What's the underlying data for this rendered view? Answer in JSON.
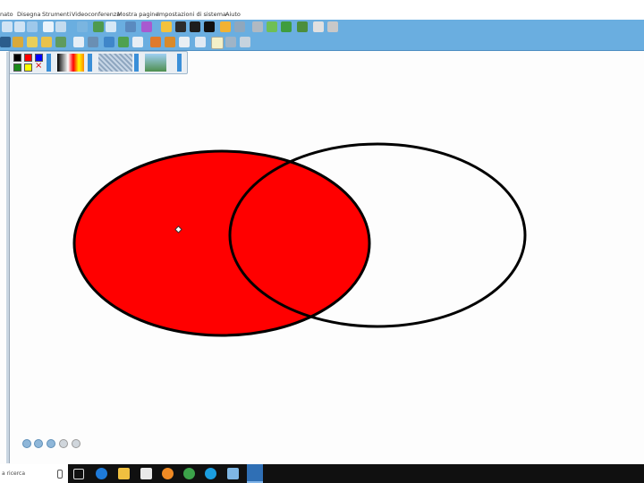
{
  "menu": {
    "items": [
      "nato",
      "Disegna",
      "Strumenti",
      "Videoconferenza",
      "Mostra pagine",
      "Impostazioni di sistema",
      "Aiuto"
    ]
  },
  "toolbar1": {
    "icons": [
      "zoom-in-icon",
      "zoom-out-icon",
      "zoom-fit-icon",
      "arrow-icon",
      "grid-icon",
      "globe-icon",
      "image-icon",
      "fullscreen-icon",
      "screen-icon",
      "camera-icon",
      "star-icon",
      "record-icon",
      "monitor-icon",
      "film-icon",
      "back-icon",
      "save-icon",
      "gift-icon",
      "box-icon",
      "puzzle-icon",
      "window-icon",
      "settings-icon"
    ]
  },
  "toolbar2": {
    "icons": [
      "pen-icon",
      "brush-icon",
      "highlighter-icon",
      "marker-icon",
      "magic-pen-icon",
      "eraser-icon",
      "line-icon",
      "fill-icon",
      "shape-icon",
      "triangle-icon",
      "palette-icon",
      "chart-icon",
      "ruler-icon",
      "text-icon",
      "select-icon",
      "draw-icon",
      "clear-icon"
    ]
  },
  "palette": {
    "colors": [
      "#000000",
      "#ff0000",
      "#0000ff",
      "#1a8a1a",
      "#ffff00"
    ],
    "no_fill_symbol": "×"
  },
  "canvas": {
    "shapes": [
      {
        "type": "ellipse",
        "fill": "#ff0000",
        "stroke": "#000000",
        "label": "filled-ellipse"
      },
      {
        "type": "ellipse",
        "fill": "none",
        "stroke": "#000000",
        "label": "outline-ellipse"
      }
    ]
  },
  "taskbar": {
    "search_text": "a ricerca",
    "apps": [
      "task-view-icon",
      "edge-icon",
      "explorer-icon",
      "store-icon",
      "firefox-icon",
      "chrome-icon",
      "skype-icon",
      "notes-icon",
      "whiteboard-icon"
    ]
  }
}
